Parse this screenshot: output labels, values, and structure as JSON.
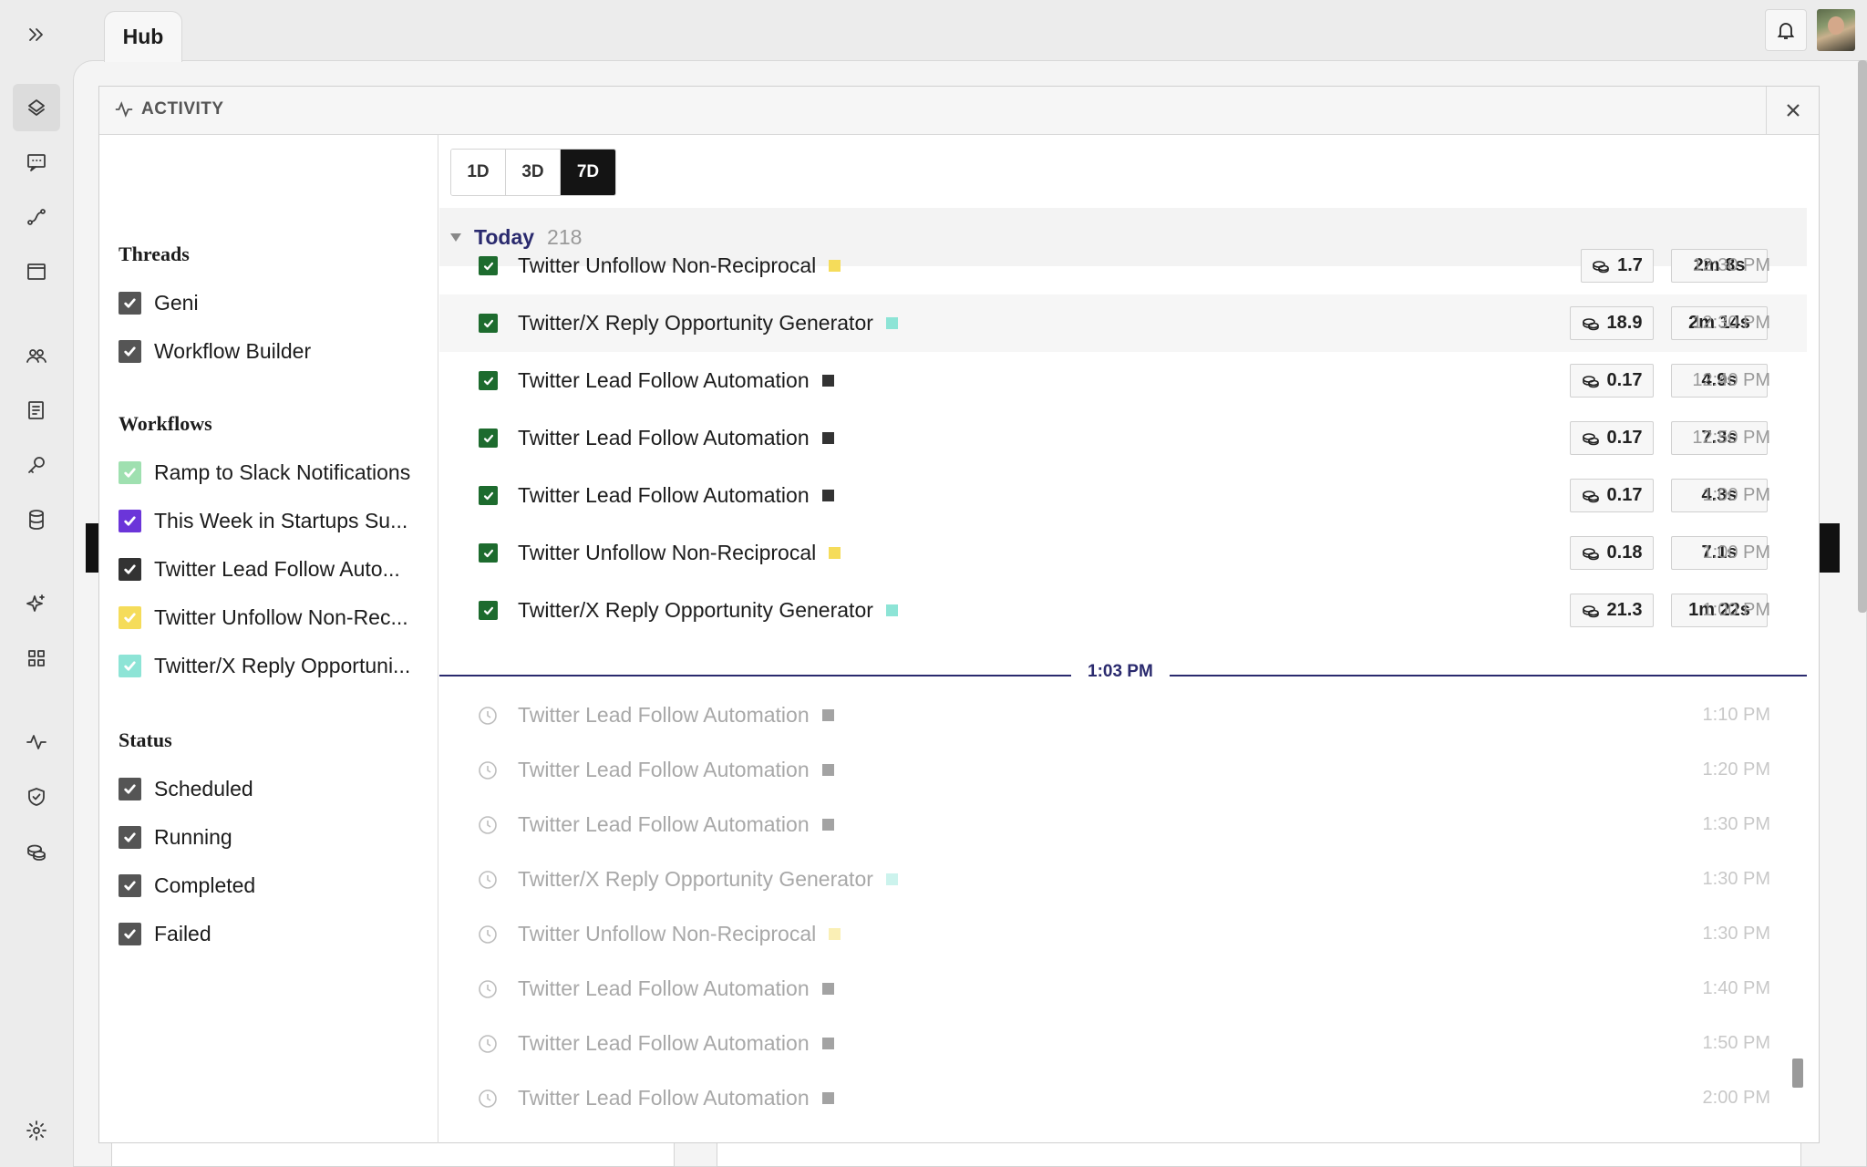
{
  "tab": {
    "title": "Hub"
  },
  "rail": {
    "icons": [
      "expand-icon",
      "logo-icon",
      "chat-icon",
      "route-icon",
      "window-icon",
      "users-icon",
      "notes-icon",
      "key-icon",
      "database-icon",
      "sparkle-icon",
      "grid-icon",
      "activity-icon",
      "shield-icon",
      "coins-icon",
      "settings-icon"
    ]
  },
  "modal": {
    "title": "ACTIVITY",
    "close_icon": "close-icon"
  },
  "filters": {
    "threads_title": "Threads",
    "threads": [
      {
        "label": "Geni",
        "color": "#555555"
      },
      {
        "label": "Workflow Builder",
        "color": "#555555"
      }
    ],
    "workflows_title": "Workflows",
    "workflows": [
      {
        "label": "Ramp to Slack Notifications",
        "color": "#9fe0b0"
      },
      {
        "label": "This Week in Startups Su...",
        "color": "#6b35d9"
      },
      {
        "label": "Twitter Lead Follow Auto...",
        "color": "#333333"
      },
      {
        "label": "Twitter Unfollow Non-Rec...",
        "color": "#f5dc5a"
      },
      {
        "label": "Twitter/X Reply Opportuni...",
        "color": "#8de4d6"
      }
    ],
    "status_title": "Status",
    "statuses": [
      {
        "label": "Scheduled",
        "color": "#555555"
      },
      {
        "label": "Running",
        "color": "#555555"
      },
      {
        "label": "Completed",
        "color": "#555555"
      },
      {
        "label": "Failed",
        "color": "#555555"
      }
    ]
  },
  "range": {
    "options": [
      "1D",
      "3D",
      "7D"
    ],
    "selected": "7D"
  },
  "group": {
    "label": "Today",
    "count": "218"
  },
  "now_marker": "1:03 PM",
  "completed_runs": [
    {
      "name": "Twitter Unfollow Non-Reciprocal",
      "color": "#f5dc5a",
      "cost": "1.7",
      "duration": "2m 8s",
      "time": "12:30 PM"
    },
    {
      "name": "Twitter/X Reply Opportunity Generator",
      "color": "#8de4d6",
      "cost": "18.9",
      "duration": "2m 14s",
      "time": "12:30 PM"
    },
    {
      "name": "Twitter Lead Follow Automation",
      "color": "#333333",
      "cost": "0.17",
      "duration": "4.9s",
      "time": "12:40 PM"
    },
    {
      "name": "Twitter Lead Follow Automation",
      "color": "#333333",
      "cost": "0.17",
      "duration": "7.3s",
      "time": "12:50 PM"
    },
    {
      "name": "Twitter Lead Follow Automation",
      "color": "#333333",
      "cost": "0.17",
      "duration": "4.3s",
      "time": "1:00 PM"
    },
    {
      "name": "Twitter Unfollow Non-Reciprocal",
      "color": "#f5dc5a",
      "cost": "0.18",
      "duration": "7.1s",
      "time": "1:00 PM"
    },
    {
      "name": "Twitter/X Reply Opportunity Generator",
      "color": "#8de4d6",
      "cost": "21.3",
      "duration": "1m 22s",
      "time": "1:00 PM"
    }
  ],
  "scheduled_runs": [
    {
      "name": "Twitter Lead Follow Automation",
      "color": "#333333",
      "time": "1:10 PM"
    },
    {
      "name": "Twitter Lead Follow Automation",
      "color": "#333333",
      "time": "1:20 PM"
    },
    {
      "name": "Twitter Lead Follow Automation",
      "color": "#333333",
      "time": "1:30 PM"
    },
    {
      "name": "Twitter/X Reply Opportunity Generator",
      "color": "#8de4d6",
      "time": "1:30 PM"
    },
    {
      "name": "Twitter Unfollow Non-Reciprocal",
      "color": "#f5dc5a",
      "time": "1:30 PM"
    },
    {
      "name": "Twitter Lead Follow Automation",
      "color": "#333333",
      "time": "1:40 PM"
    },
    {
      "name": "Twitter Lead Follow Automation",
      "color": "#333333",
      "time": "1:50 PM"
    },
    {
      "name": "Twitter Lead Follow Automation",
      "color": "#333333",
      "time": "2:00 PM"
    }
  ],
  "colors": {
    "accent": "#2a2a6e",
    "completed": "#1d6b2e",
    "selected_range": "#141414"
  }
}
